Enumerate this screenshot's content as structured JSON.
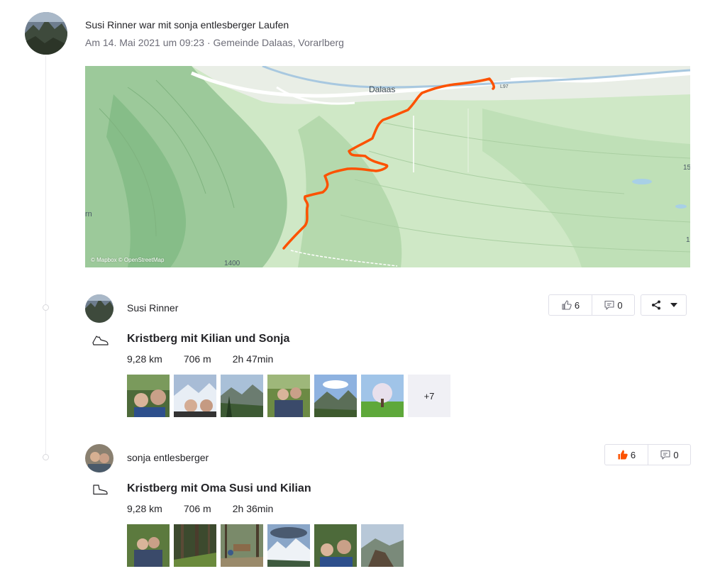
{
  "group": {
    "header": "Susi Rinner war mit sonja entlesberger Laufen",
    "meta": "Am 14. Mai 2021 um 09:23 · Gemeinde Dalaas, Vorarlberg",
    "avatar_icon": "profile-photo-icon"
  },
  "map": {
    "town_label": "Dalaas",
    "road_label": "L97",
    "elevation_label_bottom": "1400",
    "edge_label_left": "rn",
    "edge_label_right_1": "15",
    "edge_label_right_2": "1",
    "attribution": "© Mapbox © OpenStreetMap",
    "route_color": "#fc5200"
  },
  "activities": [
    {
      "athlete": "Susi Rinner",
      "sport_icon": "running-shoe-icon",
      "title": "Kristberg mit Kilian und Sonja",
      "distance": "9,28 km",
      "elevation": "706 m",
      "time": "2h 47min",
      "photos_more": "+7",
      "kudos_count": "6",
      "kudos_given": false,
      "comment_count": "0",
      "share_icon": "share-icon"
    },
    {
      "athlete": "sonja entlesberger",
      "sport_icon": "hiking-boot-icon",
      "title": "Kristberg mit Oma Susi und Kilian",
      "distance": "9,28 km",
      "elevation": "706 m",
      "time": "2h 36min",
      "kudos_count": "6",
      "kudos_given": true,
      "comment_count": "0"
    }
  ],
  "colors": {
    "kudos_active": "#fc5200",
    "text": "#242428",
    "muted": "#6d6d78"
  }
}
